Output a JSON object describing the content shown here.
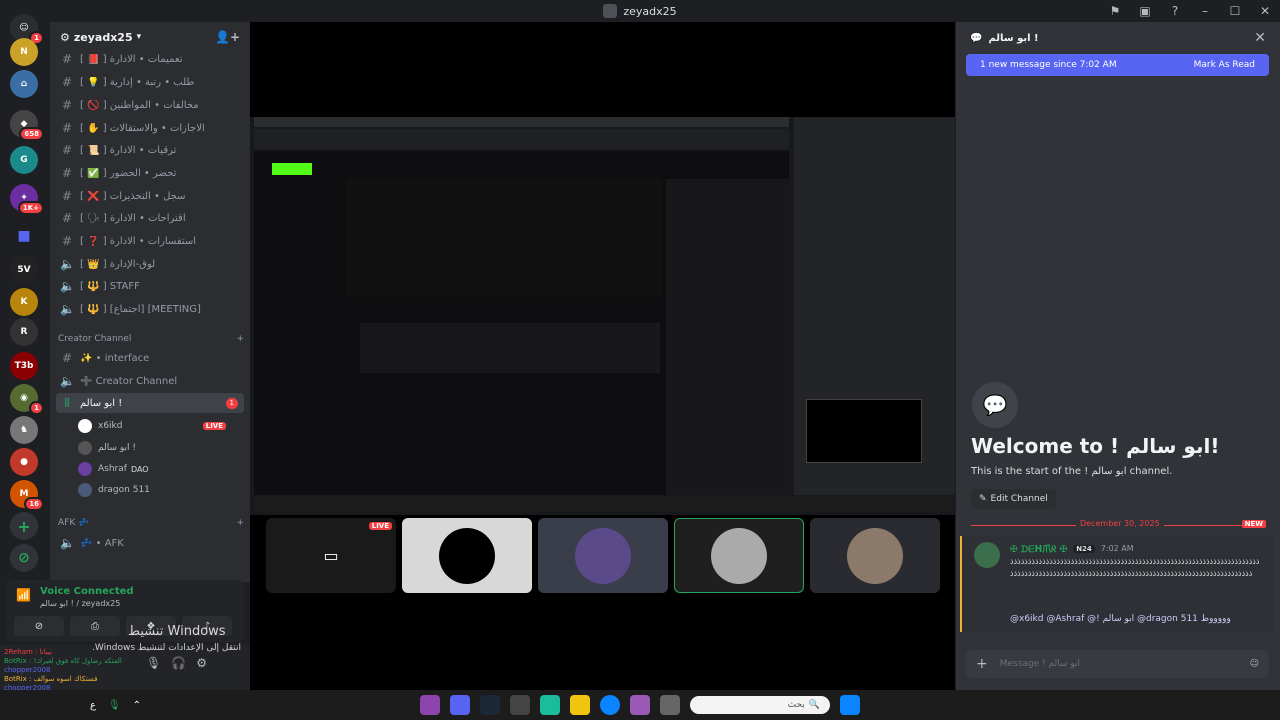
{
  "window": {
    "title": "zeyadx25"
  },
  "server_rail": {
    "badges": [
      "1",
      "658",
      "1K+",
      "1",
      "16"
    ]
  },
  "guild": {
    "name": "zeyadx25"
  },
  "channels": [
    {
      "name": "[ 📕 ] تعميمات • الادارة"
    },
    {
      "name": "[ 💡 ] طلب • رتبة • إدارية"
    },
    {
      "name": "[ 🚫 ] مخالفات • المواطنين"
    },
    {
      "name": "[ ✋ ] الاجازات • والاستقالات"
    },
    {
      "name": "[ 📜 ] ترقيات • الادارة"
    },
    {
      "name": "[ ✅ ] تحضر • الحضور"
    },
    {
      "name": "[ ❌ ] سجل • التحذيرات"
    },
    {
      "name": "[ 🗣 ] اقتراحات • الادارة"
    },
    {
      "name": "[ ❓ ] استفسارات • الادارة"
    },
    {
      "name": "[ 👑 ] لوق-الإدارة"
    },
    {
      "name": "[ 🔱 ] STAFF"
    },
    {
      "name": "[ 🔱 ] [اجتماع] [MEETING]"
    }
  ],
  "creator_category": "Creator Channel",
  "creator_channels": [
    {
      "name": "✨ • interface"
    },
    {
      "name": "➕ Creator Channel"
    },
    {
      "name": "ابو سالم !",
      "count": "1"
    }
  ],
  "voice_users": [
    {
      "name": "x6ikd",
      "live": "LIVE"
    },
    {
      "name": "ابو سالم !"
    },
    {
      "name": "Ashraf",
      "tag": "DAO"
    },
    {
      "name": "dragon 511"
    }
  ],
  "afk_category": "AFK 💤",
  "afk_channel": "💤 • AFK",
  "voice_panel": {
    "status": "Voice Connected",
    "channel": "ابو سالم ! / zeyadx25"
  },
  "activation": {
    "line1": "تنشيط Windows",
    "line2": "انتقل إلى الإعدادات لتنشيط Windows."
  },
  "ticker": {
    "l1": "2Reham : بيبانا",
    "l2": "BotRix : !المتكه رضاول كاه فوق لغيرك",
    "l3": "chopper2008",
    "l4": "BotRix : فستكاك اسوه سوالف",
    "l5": "chopper2008"
  },
  "stream": {
    "live_label": "LIVE"
  },
  "chat": {
    "channel": "ابو سالم !",
    "new_banner": "1 new message since 7:02 AM",
    "mark_read": "Mark As Read",
    "welcome_title": "Welcome to ! ابو سالم!",
    "welcome_sub": "This is the start of the ! ابو سالم channel.",
    "edit_channel": "Edit Channel",
    "date": "December 30, 2025",
    "new_tag": "NEW",
    "message": {
      "author": "✠ ᗪᗴᕼ爪ᖇ ✠",
      "tag": "N24",
      "time": "7:02 AM",
      "body": "ذذذذذذذذذذذذذذذذذذذذذذذذذذذذذذذذذذذذذذذذذذذذذذذذذذذذذذذذذذذذذذذذذذذذذذذذذذذذذذذذذذذذذذذذذذذذذذذذذذذذذذذذذذذذذذذذذذذذذذذذذذذذذذذذذذذذذذذذذذ",
      "mentions": "@x6ikd @Ashraf @! ابو سالم @dragon 511 وووووط"
    },
    "composer_placeholder": "Message ! ابو سالم"
  },
  "taskbar": {
    "search": "بحث",
    "lang": "ع"
  }
}
